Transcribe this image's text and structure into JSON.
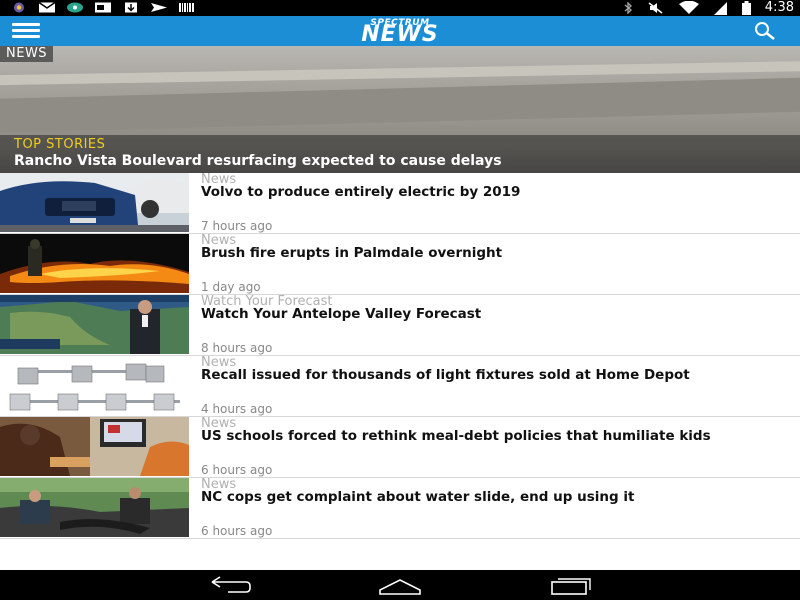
{
  "status_bar": {
    "time": "4:38",
    "left_icons": [
      "app-icon",
      "gmail-icon",
      "chat-icon",
      "news-icon",
      "download-icon",
      "mail-send-icon",
      "barcode-icon"
    ],
    "right_icons": [
      "bluetooth-icon",
      "mute-icon",
      "wifi-icon",
      "signal-icon",
      "battery-icon"
    ]
  },
  "app_bar": {
    "logo_small": "SPECTRUM",
    "logo_big": "NEWS",
    "menu_icon": "hamburger-menu-icon",
    "search_icon": "search-icon",
    "color": "#1b8ed6"
  },
  "hero": {
    "badge": "NEWS",
    "kicker": "TOP STORIES",
    "title": "Rancho Vista Boulevard resurfacing expected to cause delays",
    "kicker_color": "#f2cc1d"
  },
  "articles": [
    {
      "category": "News",
      "title": "Volvo to produce entirely electric by 2019",
      "time": "7 hours ago"
    },
    {
      "category": "News",
      "title": "Brush fire erupts in Palmdale overnight",
      "time": "1 day ago"
    },
    {
      "category": "Watch Your Forecast",
      "title": "Watch Your Antelope Valley Forecast",
      "time": "8 hours ago"
    },
    {
      "category": "News",
      "title": "Recall issued for thousands of light fixtures sold at Home Depot",
      "time": "4 hours ago"
    },
    {
      "category": "News",
      "title": "US schools forced to rethink meal-debt policies that humiliate kids",
      "time": "6 hours ago"
    },
    {
      "category": "News",
      "title": "NC cops get complaint about water slide, end up using it",
      "time": "6 hours ago"
    }
  ],
  "nav_bar": {
    "buttons": [
      "back-icon",
      "home-icon",
      "recents-icon"
    ]
  }
}
